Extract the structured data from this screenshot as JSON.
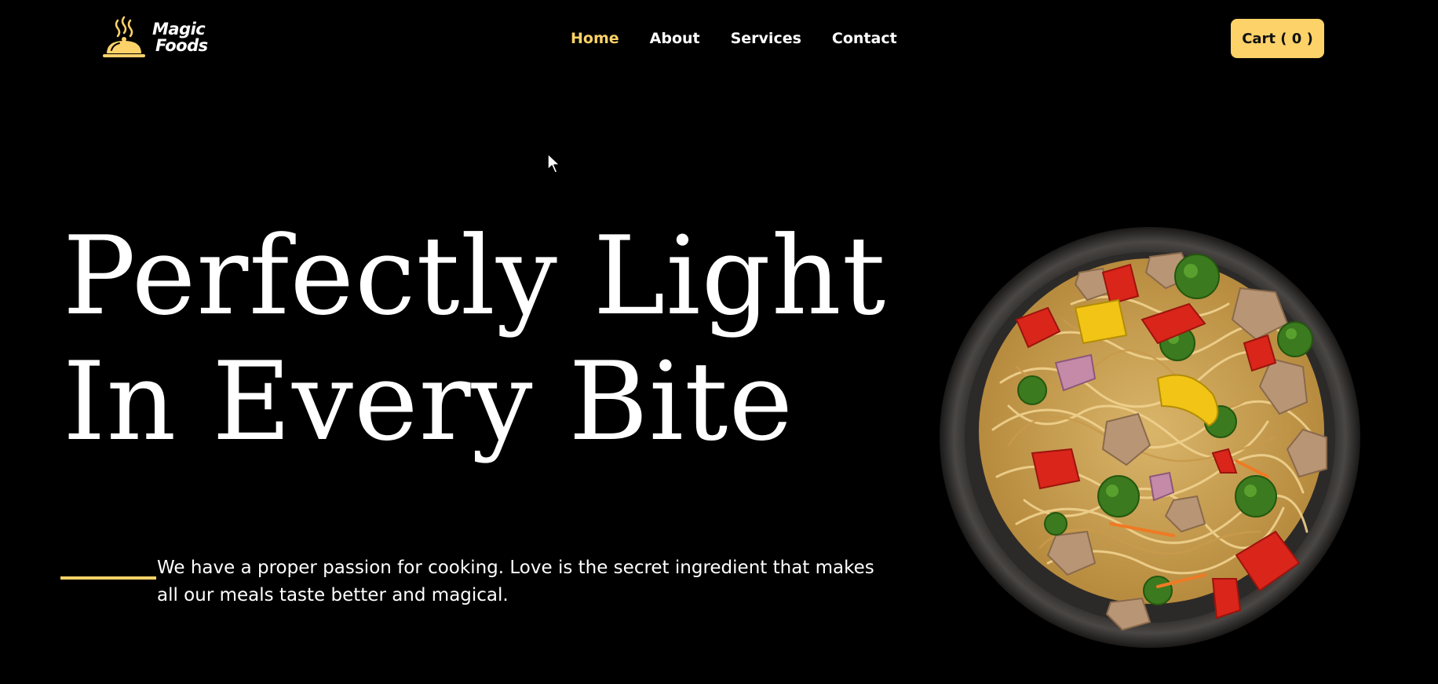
{
  "brand": {
    "line1": "Magic",
    "line2": "Foods",
    "icon": "cloche-icon",
    "accent_color": "#fdd268"
  },
  "nav": {
    "items": [
      {
        "label": "Home",
        "active": true
      },
      {
        "label": "About",
        "active": false
      },
      {
        "label": "Services",
        "active": false
      },
      {
        "label": "Contact",
        "active": false
      }
    ]
  },
  "cart": {
    "label": "Cart ( 0 )"
  },
  "hero": {
    "title_line1": "Perfectly Light",
    "title_line2": "In Every Bite",
    "description": "We have a proper passion for cooking. Love is the secret ingredient that makes all our meals taste better and magical."
  },
  "dish": {
    "icon": "noodle-bowl-image"
  },
  "colors": {
    "background": "#000000",
    "accent": "#fdd268",
    "text": "#ffffff"
  }
}
